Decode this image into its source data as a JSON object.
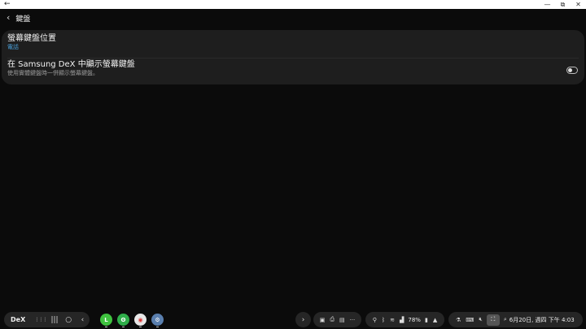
{
  "window": {
    "back_glyph": "←",
    "minimize_glyph": "—",
    "maximize_glyph": "⧉",
    "close_glyph": "✕"
  },
  "header": {
    "back_glyph": "‹",
    "title": "鍵盤"
  },
  "settings": {
    "row1": {
      "title": "螢幕鍵盤位置",
      "value": "電話"
    },
    "row2": {
      "title": "在 Samsung DeX 中顯示螢幕鍵盤",
      "description": "使用實體鍵盤時一併顯示螢幕鍵盤。",
      "toggle_on": false
    }
  },
  "taskbar": {
    "dex_label": "DeX",
    "apps_icon": "⋮⋮⋮",
    "recents_icon": "|||",
    "home_icon": "○",
    "back_icon": "‹",
    "apps": [
      {
        "name": "line-app",
        "glyph": "L",
        "color": "#3fc23f"
      },
      {
        "name": "phone-dialer-app",
        "glyph": "ʘ",
        "color": "#2fae4a"
      },
      {
        "name": "chrome-app",
        "glyph": "◉",
        "color": "#e8e8e8"
      },
      {
        "name": "settings-app",
        "glyph": "⚙",
        "color": "#5a7fae"
      }
    ],
    "expand_icon": "›",
    "quick_icons": [
      "▣",
      "⎙",
      "▤",
      "···"
    ],
    "battery_text": "78%",
    "clock_text": "6月20日, 週四 下午 4:03"
  }
}
